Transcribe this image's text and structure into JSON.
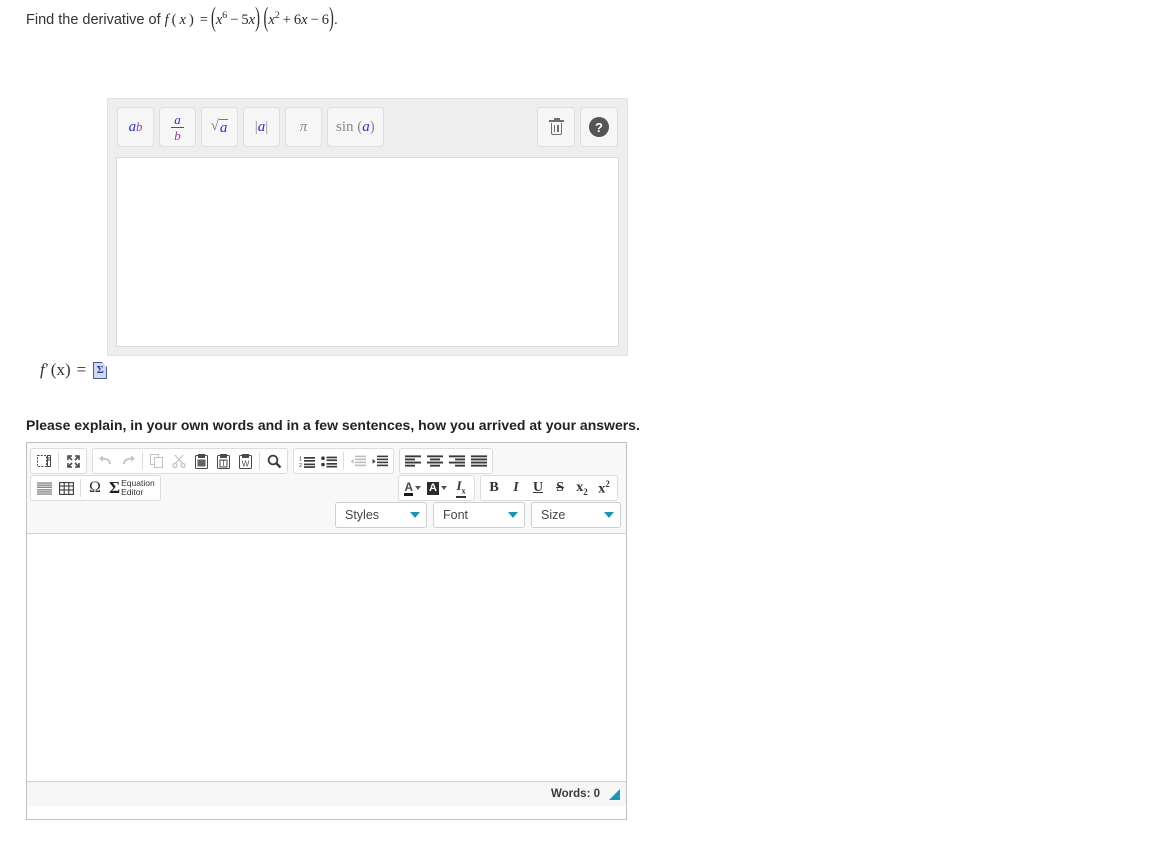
{
  "question": {
    "prefix": "Find the derivative of",
    "function_name": "f",
    "variable": "x",
    "expression_latex": "f(x) = (x^6 - 5x)(x^2 + 6x - 6)",
    "factor1": {
      "term1_base": "x",
      "term1_exp": "6",
      "op": "−",
      "term2_coef": "5",
      "term2_var": "x"
    },
    "factor2": {
      "term1_base": "x",
      "term1_exp": "2",
      "op1": "+",
      "term2_coef": "6",
      "term2_var": "x",
      "op2": "−",
      "term3": "6"
    },
    "period": "."
  },
  "math_editor": {
    "toolbar_buttons": [
      {
        "name": "exponent-button",
        "label": "a^b",
        "tooltip": "Exponent"
      },
      {
        "name": "fraction-button",
        "numerator": "a",
        "denominator": "b",
        "tooltip": "Fraction"
      },
      {
        "name": "square-root-button",
        "label": "√a",
        "tooltip": "Square root"
      },
      {
        "name": "absolute-value-button",
        "label": "|a|",
        "tooltip": "Absolute value"
      },
      {
        "name": "pi-button",
        "label": "π",
        "tooltip": "Pi"
      },
      {
        "name": "sine-button",
        "label": "sin (a)",
        "tooltip": "Sine"
      }
    ],
    "trash_label": "Clear",
    "help_label": "?",
    "input_value": "",
    "input_placeholder": ""
  },
  "answer_row": {
    "label_f": "f",
    "label_prime": "′",
    "label_paren_x": "(x)",
    "label_equals": "=",
    "equation_icon": "equation-editor-icon",
    "equation_icon_glyph": "Σ"
  },
  "explain": {
    "prompt": "Please explain, in your own words and in a few sentences, how you arrived at your answers."
  },
  "ckeditor": {
    "row1_group1": [
      {
        "name": "source-button",
        "icon": "source-icon",
        "title": "Source"
      },
      {
        "name": "maximize-button",
        "icon": "maximize-icon",
        "title": "Maximize"
      }
    ],
    "row1_group2": [
      {
        "name": "undo-button",
        "icon": "undo-icon",
        "title": "Undo",
        "disabled": true
      },
      {
        "name": "redo-button",
        "icon": "redo-icon",
        "title": "Redo",
        "disabled": true
      },
      {
        "name": "copy-button",
        "icon": "copy-icon",
        "title": "Copy",
        "disabled": true
      },
      {
        "name": "cut-button",
        "icon": "scissors-icon",
        "title": "Cut",
        "disabled": true
      },
      {
        "name": "paste-button",
        "icon": "clipboard-icon",
        "title": "Paste"
      },
      {
        "name": "paste-as-text-button",
        "icon": "clipboard-text-icon",
        "title": "Paste as plain text"
      },
      {
        "name": "paste-from-word-button",
        "icon": "clipboard-word-icon",
        "title": "Paste from Word"
      },
      {
        "name": "find-button",
        "icon": "magnifier-icon",
        "title": "Find"
      }
    ],
    "row1_group3": [
      {
        "name": "numbered-list-button",
        "icon": "numbered-list-icon",
        "title": "Insert/Remove Numbered List"
      },
      {
        "name": "bulleted-list-button",
        "icon": "bulleted-list-icon",
        "title": "Insert/Remove Bulleted List"
      },
      {
        "name": "outdent-button",
        "icon": "outdent-icon",
        "title": "Decrease Indent",
        "disabled": true
      },
      {
        "name": "indent-button",
        "icon": "indent-icon",
        "title": "Increase Indent"
      }
    ],
    "row1_group4": [
      {
        "name": "align-left-button",
        "icon": "align-left-icon",
        "title": "Align Left"
      },
      {
        "name": "align-center-button",
        "icon": "align-center-icon",
        "title": "Center"
      },
      {
        "name": "align-right-button",
        "icon": "align-right-icon",
        "title": "Align Right"
      },
      {
        "name": "justify-button",
        "icon": "justify-icon",
        "title": "Justify"
      }
    ],
    "row2_group1": [
      {
        "name": "horizontal-rule-button",
        "icon": "horizontal-rule-icon",
        "title": "Insert Horizontal Line"
      },
      {
        "name": "table-button",
        "icon": "table-icon",
        "title": "Table"
      },
      {
        "name": "special-char-button",
        "icon": "omega-icon",
        "glyph": "Ω",
        "title": "Insert Special Character"
      }
    ],
    "equation_editor_button": {
      "name": "equation-editor-button",
      "glyph": "Σ",
      "label_line1": "Equation",
      "label_line2": "Editor"
    },
    "row2_group_color": [
      {
        "name": "text-color-button",
        "icon": "text-color-icon",
        "glyph": "A",
        "title": "Text Color"
      },
      {
        "name": "background-color-button",
        "icon": "background-color-icon",
        "glyph": "A",
        "title": "Background Color"
      },
      {
        "name": "remove-format-button",
        "icon": "remove-format-icon",
        "glyph": "Iₓ",
        "title": "Remove Format"
      }
    ],
    "row2_group_format": [
      {
        "name": "bold-button",
        "glyph": "B",
        "title": "Bold"
      },
      {
        "name": "italic-button",
        "glyph": "I",
        "title": "Italic"
      },
      {
        "name": "underline-button",
        "glyph": "U",
        "title": "Underline"
      },
      {
        "name": "strikethrough-button",
        "glyph": "S",
        "title": "Strike Through"
      },
      {
        "name": "subscript-button",
        "glyph": "x",
        "sub": "2",
        "title": "Subscript"
      },
      {
        "name": "superscript-button",
        "glyph": "x",
        "sup": "2",
        "title": "Superscript"
      }
    ],
    "dropdowns": [
      {
        "name": "styles-dropdown",
        "label": "Styles"
      },
      {
        "name": "font-dropdown",
        "label": "Font"
      },
      {
        "name": "size-dropdown",
        "label": "Size"
      }
    ],
    "body_value": "",
    "footer": {
      "word_count_label": "Words: 0"
    }
  },
  "colors": {
    "accent_teal": "#1f95b5",
    "toolbar_bg": "#f8f8f8",
    "math_toolbar_bg": "#eeeeee",
    "var_a": "#2e2ecc",
    "var_b": "#993399",
    "help_circle": "#555555"
  }
}
